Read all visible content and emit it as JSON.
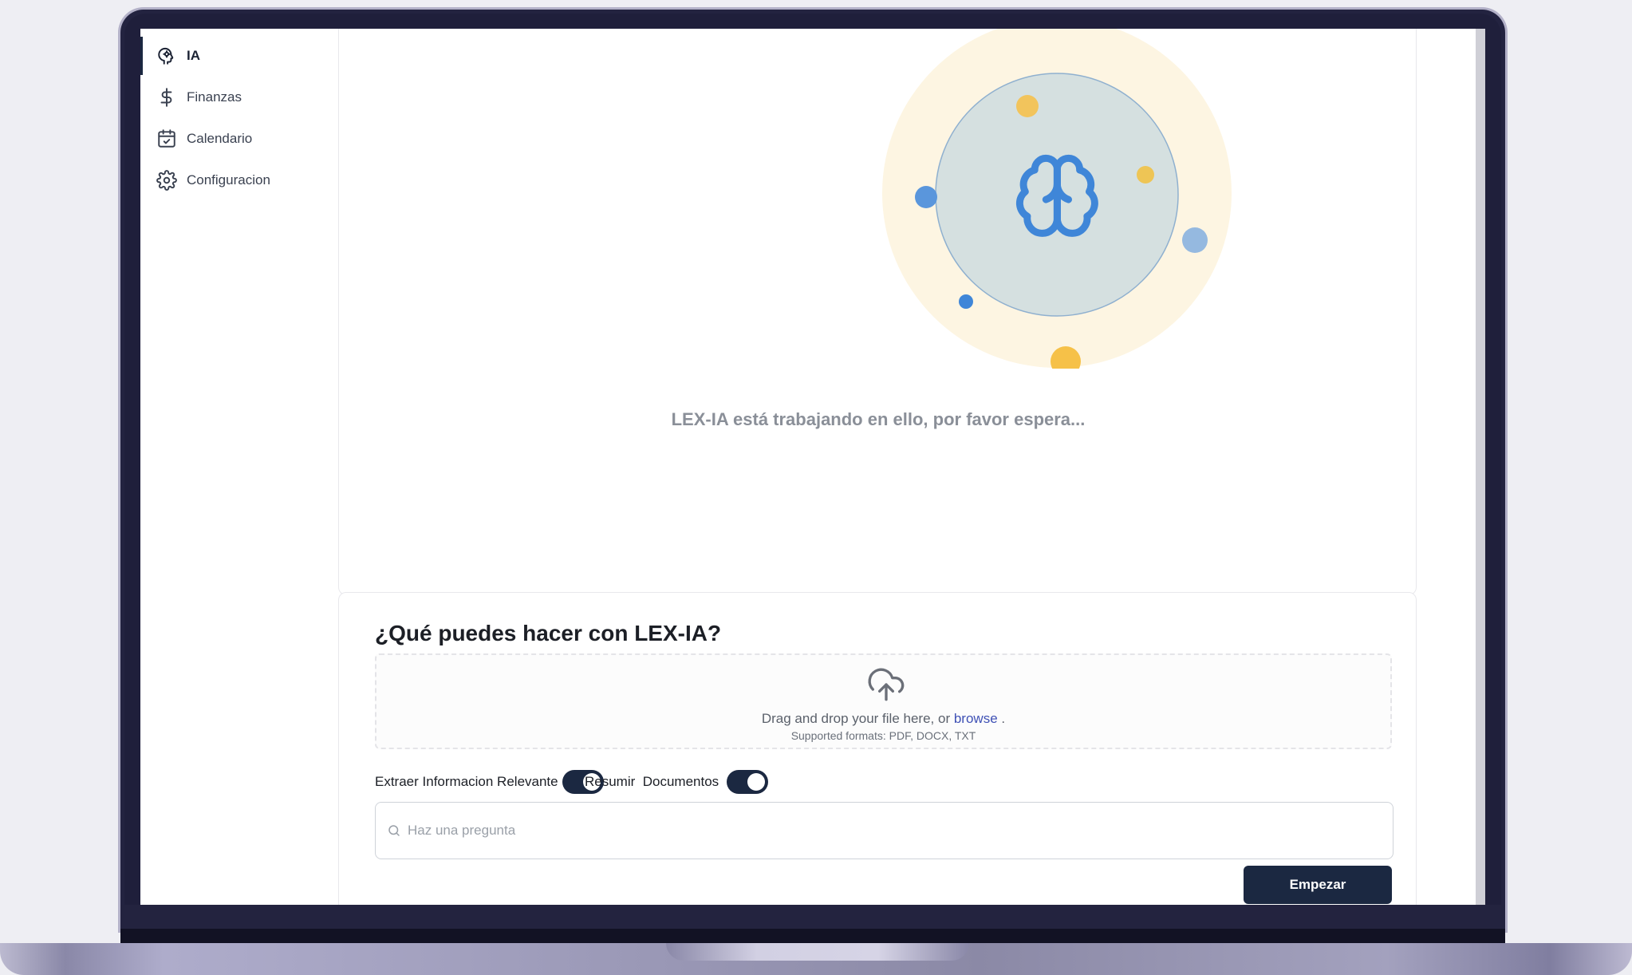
{
  "sidebar": {
    "items": [
      {
        "label": "IA",
        "icon": "brain-gear-icon",
        "active": true
      },
      {
        "label": "Finanzas",
        "icon": "dollar-icon",
        "active": false
      },
      {
        "label": "Calendario",
        "icon": "calendar-check-icon",
        "active": false
      },
      {
        "label": "Configuracion",
        "icon": "gear-icon",
        "active": false
      }
    ]
  },
  "loading": {
    "icon": "brain-icon",
    "message": "LEX-IA está trabajando en ello, por favor espera..."
  },
  "features": {
    "title": "¿Qué puedes hacer con LEX-IA?",
    "upload": {
      "icon": "cloud-upload-icon",
      "text_before": "Drag and drop your file here, or",
      "browse_label": "browse",
      "text_after": ".",
      "formats": "Supported formats: PDF, DOCX, TXT"
    },
    "toggles": [
      {
        "label": "Extraer Informacion Relevante",
        "on": true
      },
      {
        "label": "Resumir  Documentos",
        "on": true
      }
    ],
    "question": {
      "placeholder": "Haz una pregunta",
      "value": ""
    },
    "start_label": "Empezar"
  },
  "colors": {
    "accent": "#1b2841",
    "brain": "#3f86d8",
    "link": "#3f51b5",
    "orbit_dot_yellow": "#f5c04a"
  }
}
